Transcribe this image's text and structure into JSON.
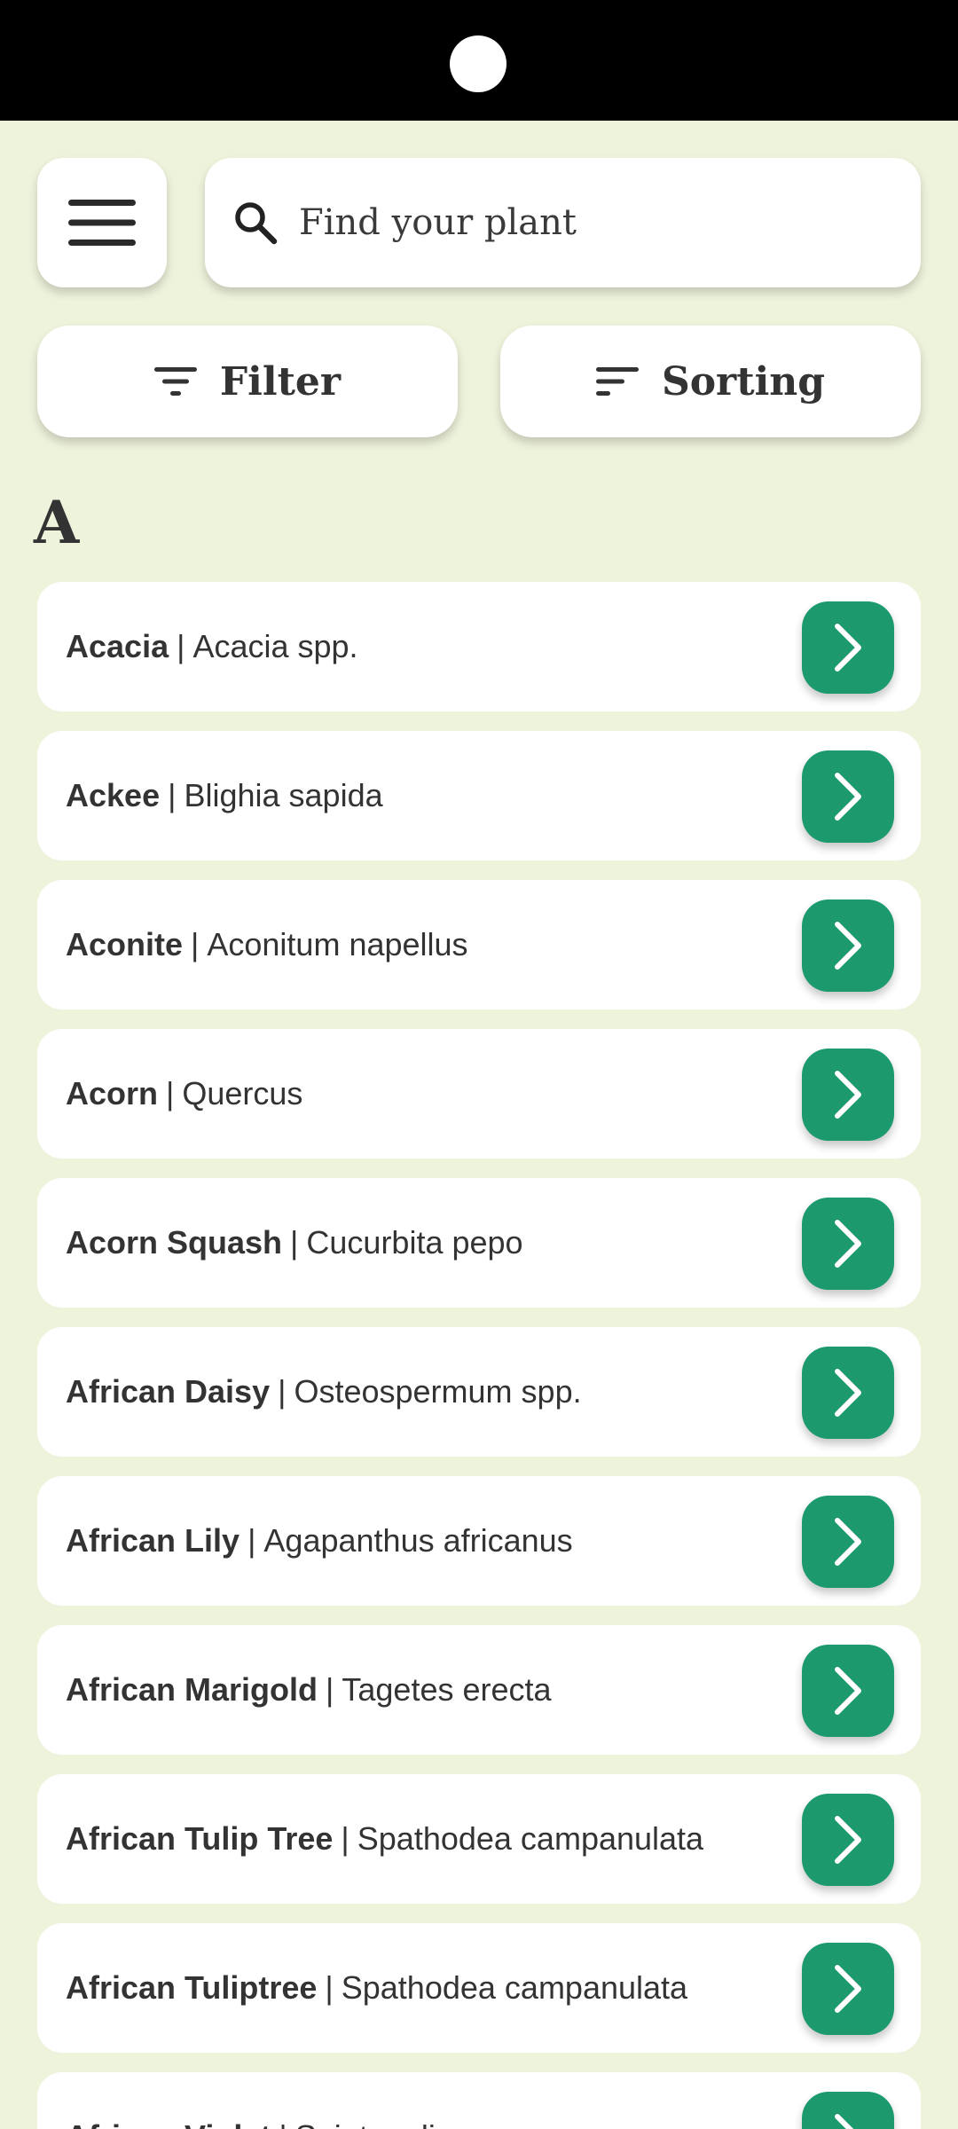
{
  "search": {
    "placeholder": "Find your plant",
    "value": ""
  },
  "toolbar": {
    "filter_label": "Filter",
    "sorting_label": "Sorting"
  },
  "section": {
    "letter": "A"
  },
  "plants": [
    {
      "name": "Acacia",
      "scientific": "Acacia spp."
    },
    {
      "name": "Ackee",
      "scientific": "Blighia sapida"
    },
    {
      "name": "Aconite",
      "scientific": "Aconitum napellus"
    },
    {
      "name": "Acorn",
      "scientific": "Quercus"
    },
    {
      "name": "Acorn Squash",
      "scientific": "Cucurbita pepo"
    },
    {
      "name": "African Daisy",
      "scientific": "Osteospermum spp."
    },
    {
      "name": "African Lily",
      "scientific": "Agapanthus africanus"
    },
    {
      "name": "African Marigold",
      "scientific": "Tagetes erecta"
    },
    {
      "name": "African Tulip Tree",
      "scientific": "Spathodea campanulata"
    },
    {
      "name": "African Tuliptree",
      "scientific": "Spathodea campanulata"
    },
    {
      "name": "African Violet",
      "scientific": "Saintpaulia"
    }
  ],
  "separator": "|",
  "icons": {
    "menu": "menu-icon",
    "search": "search-icon",
    "filter": "filter-icon",
    "sort": "sort-icon",
    "go": "chevron-right-icon"
  },
  "colors": {
    "background": "#eef3dc",
    "accent": "#1c9a6e",
    "card": "#ffffff",
    "text": "#333333"
  }
}
